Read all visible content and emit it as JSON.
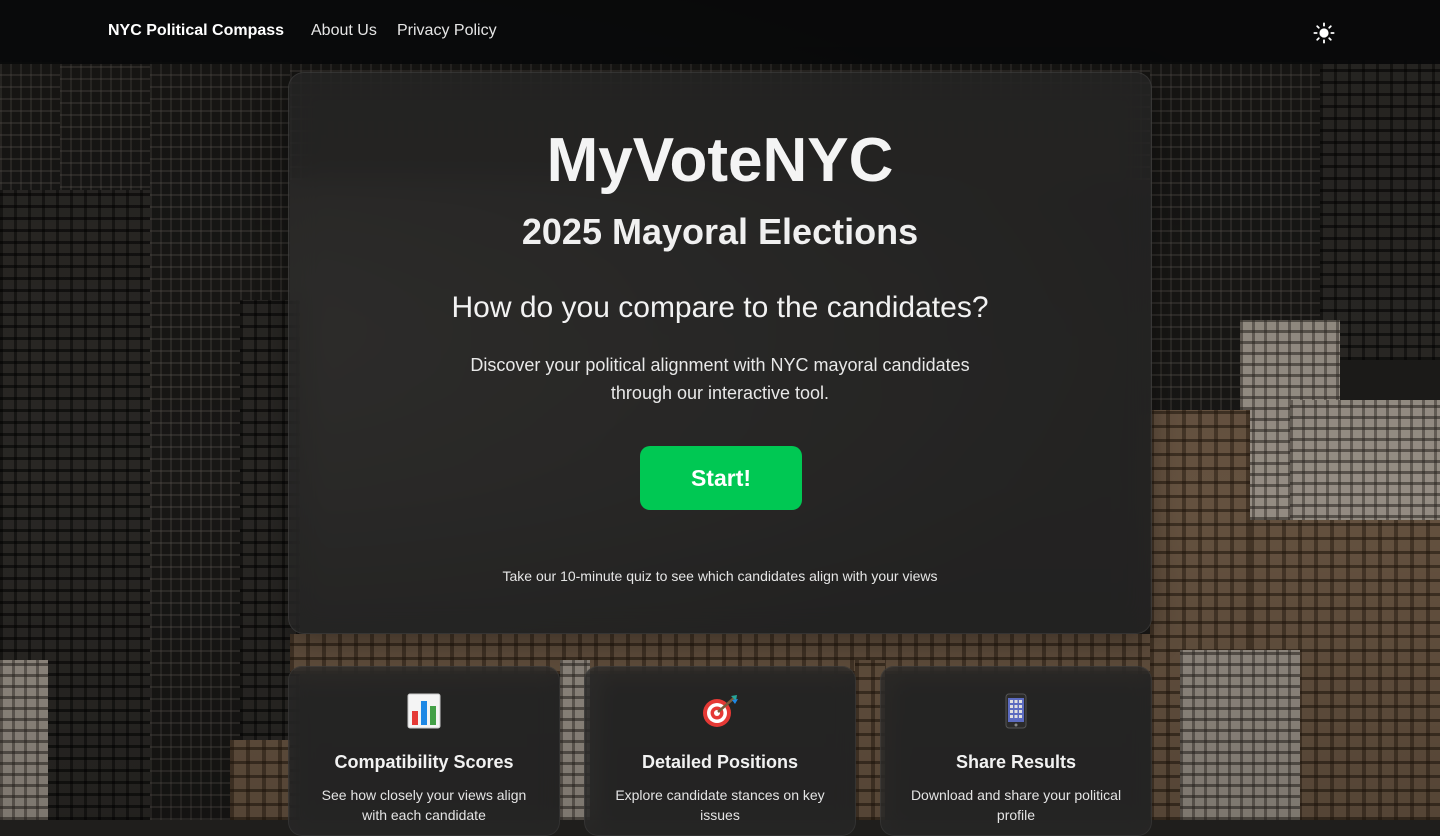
{
  "nav": {
    "brand": "NYC Political Compass",
    "links": [
      {
        "label": "About Us"
      },
      {
        "label": "Privacy Policy"
      }
    ],
    "theme_toggle_icon": "sun-icon"
  },
  "hero": {
    "title": "MyVoteNYC",
    "subtitle": "2025 Mayoral Elections",
    "question": "How do you compare to the candidates?",
    "description": "Discover your political alignment with NYC mayoral candidates through our interactive tool.",
    "start_label": "Start!",
    "note": "Take our 10-minute quiz to see which candidates align with your views"
  },
  "features": [
    {
      "icon": "bar-chart-icon",
      "title": "Compatibility Scores",
      "description": "See how closely your views align with each candidate"
    },
    {
      "icon": "target-icon",
      "title": "Detailed Positions",
      "description": "Explore candidate stances on key issues"
    },
    {
      "icon": "phone-icon",
      "title": "Share Results",
      "description": "Download and share your political profile"
    }
  ],
  "colors": {
    "accent": "#00c853",
    "navbar_bg": "#08090a",
    "text": "#ffffff"
  }
}
